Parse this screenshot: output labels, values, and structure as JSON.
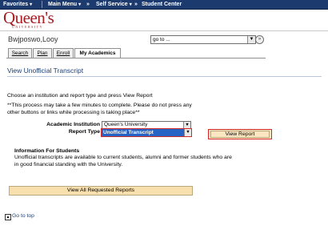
{
  "nav": {
    "favorites": "Favorites",
    "main_menu": "Main Menu",
    "self_service": "Self Service",
    "student_center": "Student Center",
    "sep": "»"
  },
  "logo": {
    "name": "Queen's",
    "sub": "UNIVERSITY"
  },
  "header": {
    "user_name": "Bwjposwo,Looy",
    "goto_value": "go to ...",
    "goto_arrow": "▼",
    "goto_go": "»"
  },
  "tabs": [
    {
      "label": "Search"
    },
    {
      "label": "Plan"
    },
    {
      "label": "Enroll"
    },
    {
      "label": "My Academics"
    }
  ],
  "page": {
    "title": "View Unofficial Transcript",
    "instruction": "Choose an institution and report type and press View Report",
    "warning": "**This process may take a few minutes to complete. Please do not press any other buttons or links while processing is taking place**"
  },
  "form": {
    "institution_label": "Academic Institution",
    "institution_value": "Queen's University",
    "report_type_label": "Report Type",
    "report_type_value": "Unofficial Transcript",
    "arrow": "▼",
    "view_report": "View Report"
  },
  "info": {
    "heading": "Information For Students",
    "body": "Unofficial transcripts are available to current students, alumni and former students who are in good financial standing with the University."
  },
  "view_all": "View All Requested Reports",
  "go_to_top": "Go to top",
  "colors": {
    "nav_bg": "#1d3a6e",
    "logo": "#a61c22",
    "title": "#1f3f73",
    "highlight": "#d22a2a",
    "selection": "#2563c4",
    "button_bg": "#fce7c2"
  }
}
